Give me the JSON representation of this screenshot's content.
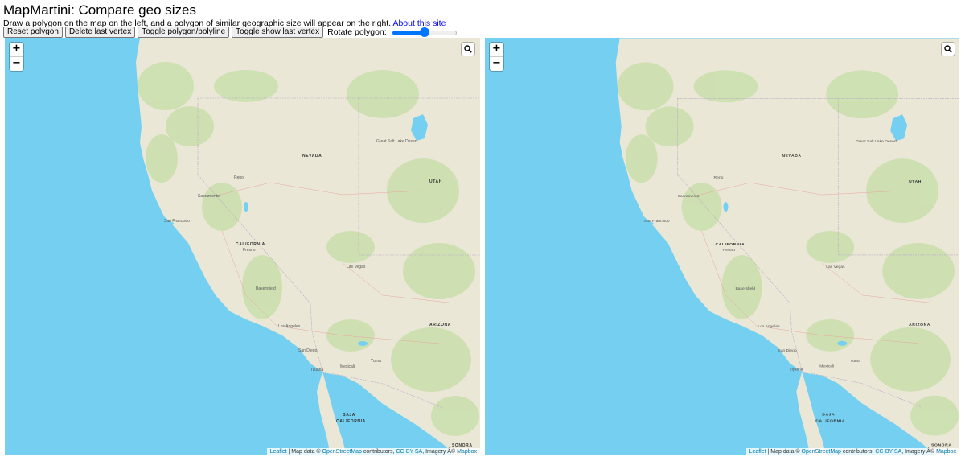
{
  "app": {
    "title": "MapMartini: Compare geo sizes",
    "subtitle": "Draw a polygon on the map on the left, and a polygon of similar geographic size will appear on the right.",
    "about_link": "About this site"
  },
  "toolbar": {
    "reset_label": "Reset polygon",
    "delete_label": "Delete last vertex",
    "toggle_poly_label": "Toggle polygon/polyline",
    "toggle_vertex_label": "Toggle show last vertex",
    "rotate_label": "Rotate polygon:",
    "rotate_value_fraction": 0.5
  },
  "map_controls": {
    "zoom_in": "+",
    "zoom_out": "−",
    "search_icon": "magnifier-icon"
  },
  "attribution": {
    "leaflet": "Leaflet",
    "sep1": " | Map data © ",
    "osm": "OpenStreetMap",
    "contrib": " contributors, ",
    "license": "CC-BY-SA",
    "imagery": ", Imagery Â© ",
    "mapbox": "Mapbox"
  },
  "map_labels": {
    "nevada": "NEVADA",
    "utah": "UTAH",
    "california": "CALIFORNIA",
    "arizona": "ARIZONA",
    "baja": "BAJA",
    "baja2": "CALIFORNIA",
    "sonora": "SONORA",
    "san_francisco": "San Francisco",
    "sacramento": "Sacramento",
    "las_vegas": "Las Vegas",
    "los_angeles": "Los Angeles",
    "san_diego": "San Diego",
    "reno": "Reno",
    "fresno": "Fresno",
    "bakersfield": "Bakersfield",
    "mexicali": "Mexicali",
    "tijuana": "Tijuana",
    "yuma": "Yuma",
    "salt_lake": "Great Salt Lake Desert"
  },
  "colors": {
    "ocean": "#75cff0",
    "land": "#ebe7d6",
    "forest": "#c9dfac",
    "lake": "#75cff0"
  }
}
